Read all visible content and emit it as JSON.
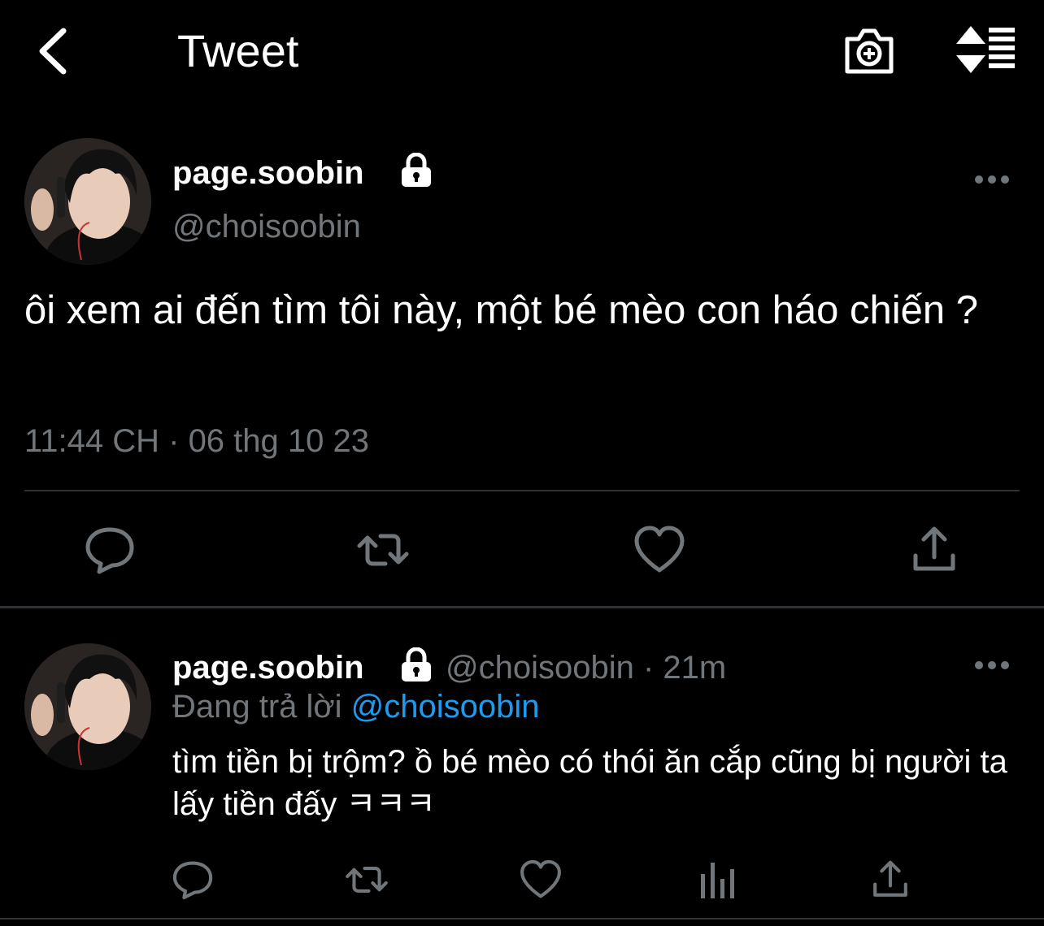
{
  "header": {
    "title": "Tweet",
    "back_icon": "chevron-left-icon",
    "camera_icon": "camera-add-icon",
    "sort_icon": "sort-icon"
  },
  "main_tweet": {
    "display_name": "page.soobin",
    "handle": "@choisoobin",
    "body": "ôi xem ai đến tìm tôi này, một bé mèo con háo chiến ?",
    "timestamp": "11:44 CH · 06 thg 10 23"
  },
  "reply_tweet": {
    "display_name": "page.soobin",
    "handle_time": "@choisoobin · 21m",
    "replying_prefix": "Đang trả lời ",
    "replying_mention": "@choisoobin",
    "body": "tìm tiền bị trộm? ồ bé mèo có thói ăn cắp cũng bị người ta lấy tiền đấy ㅋㅋㅋ"
  },
  "colors": {
    "background": "#000000",
    "text": "#ffffff",
    "secondary": "#71767b",
    "accent": "#1d9bf0",
    "divider": "#2f3336"
  }
}
